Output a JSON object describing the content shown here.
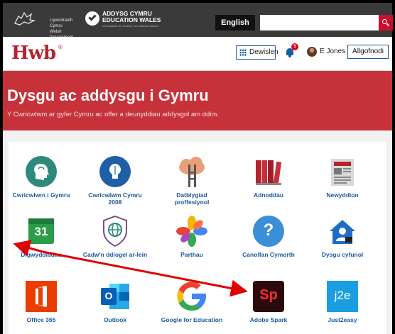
{
  "govbar": {
    "gov_text": "Llywodraeth Cymru\nWelsh Government",
    "ew_title": "ADDYSG CYMRU\nEDUCATION WALES",
    "ew_sub": "cenhadaeth ein cenedl | our national mission",
    "english_label": "English",
    "search_placeholder": ""
  },
  "header": {
    "logo": "Hwb",
    "logo_reg": "®",
    "menu_label": "Dewislen",
    "notification_count": "5",
    "user_name": "E Jones",
    "logout_label": "Allgofnodi"
  },
  "banner": {
    "title": "Dysgu ac addysgu i Gymru",
    "subtitle": "Y Cwricwlwm ar gyfer Cymru ac offer a deunyddiau addysgol am ddim."
  },
  "tiles": [
    {
      "label": "Cwricwlwm i Gymru",
      "icon": "head-profile-icon"
    },
    {
      "label": "Cwricwlwm Cymru 2008",
      "icon": "lightbulb-icon"
    },
    {
      "label": "Datblygiad proffesiynol",
      "icon": "cloud-ladder-icon"
    },
    {
      "label": "Adnoddau",
      "icon": "books-icon"
    },
    {
      "label": "Newyddion",
      "icon": "newspaper-icon"
    },
    {
      "label": "Digwyddiadau",
      "icon": "calendar-icon"
    },
    {
      "label": "Cadw'n ddiogel ar-lein",
      "icon": "shield-globe-icon"
    },
    {
      "label": "Parthau",
      "icon": "pinwheel-icon"
    },
    {
      "label": "Canolfan Cymorth",
      "icon": "help-icon"
    },
    {
      "label": "Dysgu cyfunol",
      "icon": "house-user-icon"
    },
    {
      "label": "Office 365",
      "icon": "office-icon"
    },
    {
      "label": "Outlook",
      "icon": "outlook-icon"
    },
    {
      "label": "Google for Education",
      "icon": "google-icon"
    },
    {
      "label": "Adobe Spark",
      "icon": "adobe-spark-icon"
    },
    {
      "label": "Just2easy",
      "icon": "j2e-icon"
    }
  ],
  "icon_text": {
    "calendar": "31",
    "help": "?",
    "spark": "Sp",
    "j2e": "j2e",
    "outlook": "O"
  },
  "colors": {
    "brand_red": "#c7323a",
    "link_blue": "#1a5aa0",
    "arrow_red": "#e00000"
  }
}
